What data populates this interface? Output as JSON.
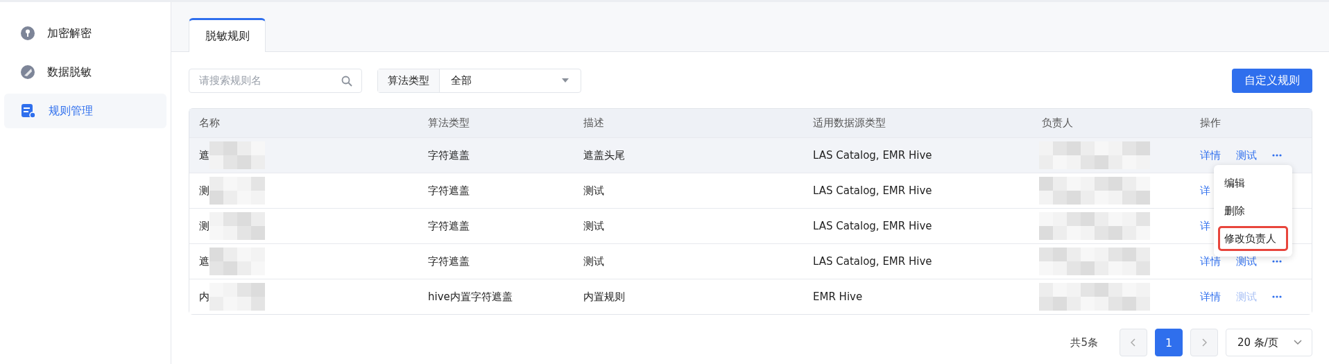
{
  "sidebar": {
    "items": [
      {
        "label": "加密解密",
        "selected": false
      },
      {
        "label": "数据脱敏",
        "selected": false
      },
      {
        "label": "规则管理",
        "selected": true
      }
    ]
  },
  "tabs": [
    {
      "label": "脱敏规则",
      "selected": true
    }
  ],
  "filters": {
    "search": {
      "placeholder": "请搜索规则名"
    },
    "select": {
      "label": "算法类型",
      "value": "全部"
    },
    "button": "自定义规则"
  },
  "table": {
    "columns": [
      "名称",
      "算法类型",
      "描述",
      "适用数据源类型",
      "负责人",
      "操作"
    ],
    "rows": [
      {
        "name": "遮",
        "algorithm": "字符遮盖",
        "description": "遮盖头尾",
        "sources": "LAS Catalog, EMR Hive",
        "highlighted": true,
        "actions": [
          {
            "label": "详情",
            "disabled": false
          },
          {
            "label": "测试",
            "disabled": false
          }
        ]
      },
      {
        "name": "测",
        "algorithm": "字符遮盖",
        "description": "测试",
        "sources": "LAS Catalog, EMR Hive",
        "highlighted": false,
        "actions": [
          {
            "label": "详",
            "disabled": false
          }
        ]
      },
      {
        "name": "测",
        "algorithm": "字符遮盖",
        "description": "测试",
        "sources": "LAS Catalog, EMR Hive",
        "highlighted": false,
        "actions": [
          {
            "label": "详",
            "disabled": false
          }
        ]
      },
      {
        "name": "遮",
        "algorithm": "字符遮盖",
        "description": "测试",
        "sources": "LAS Catalog, EMR Hive",
        "highlighted": false,
        "actions": [
          {
            "label": "详情",
            "disabled": false
          },
          {
            "label": "测试",
            "disabled": false
          }
        ]
      },
      {
        "name": "内",
        "algorithm": "hive内置字符遮盖",
        "description": "内置规则",
        "sources": "EMR Hive",
        "highlighted": false,
        "actions": [
          {
            "label": "详情",
            "disabled": false
          },
          {
            "label": "测试",
            "disabled": true
          }
        ]
      }
    ]
  },
  "menu": {
    "items": [
      {
        "label": "编辑",
        "highlighted": false
      },
      {
        "label": "删除",
        "highlighted": false
      },
      {
        "label": "修改负责人",
        "highlighted": true
      }
    ]
  },
  "pagination": {
    "total": "共5条",
    "pages": [
      {
        "label": "1",
        "selected": true
      }
    ],
    "page_size": "20 条/页"
  }
}
